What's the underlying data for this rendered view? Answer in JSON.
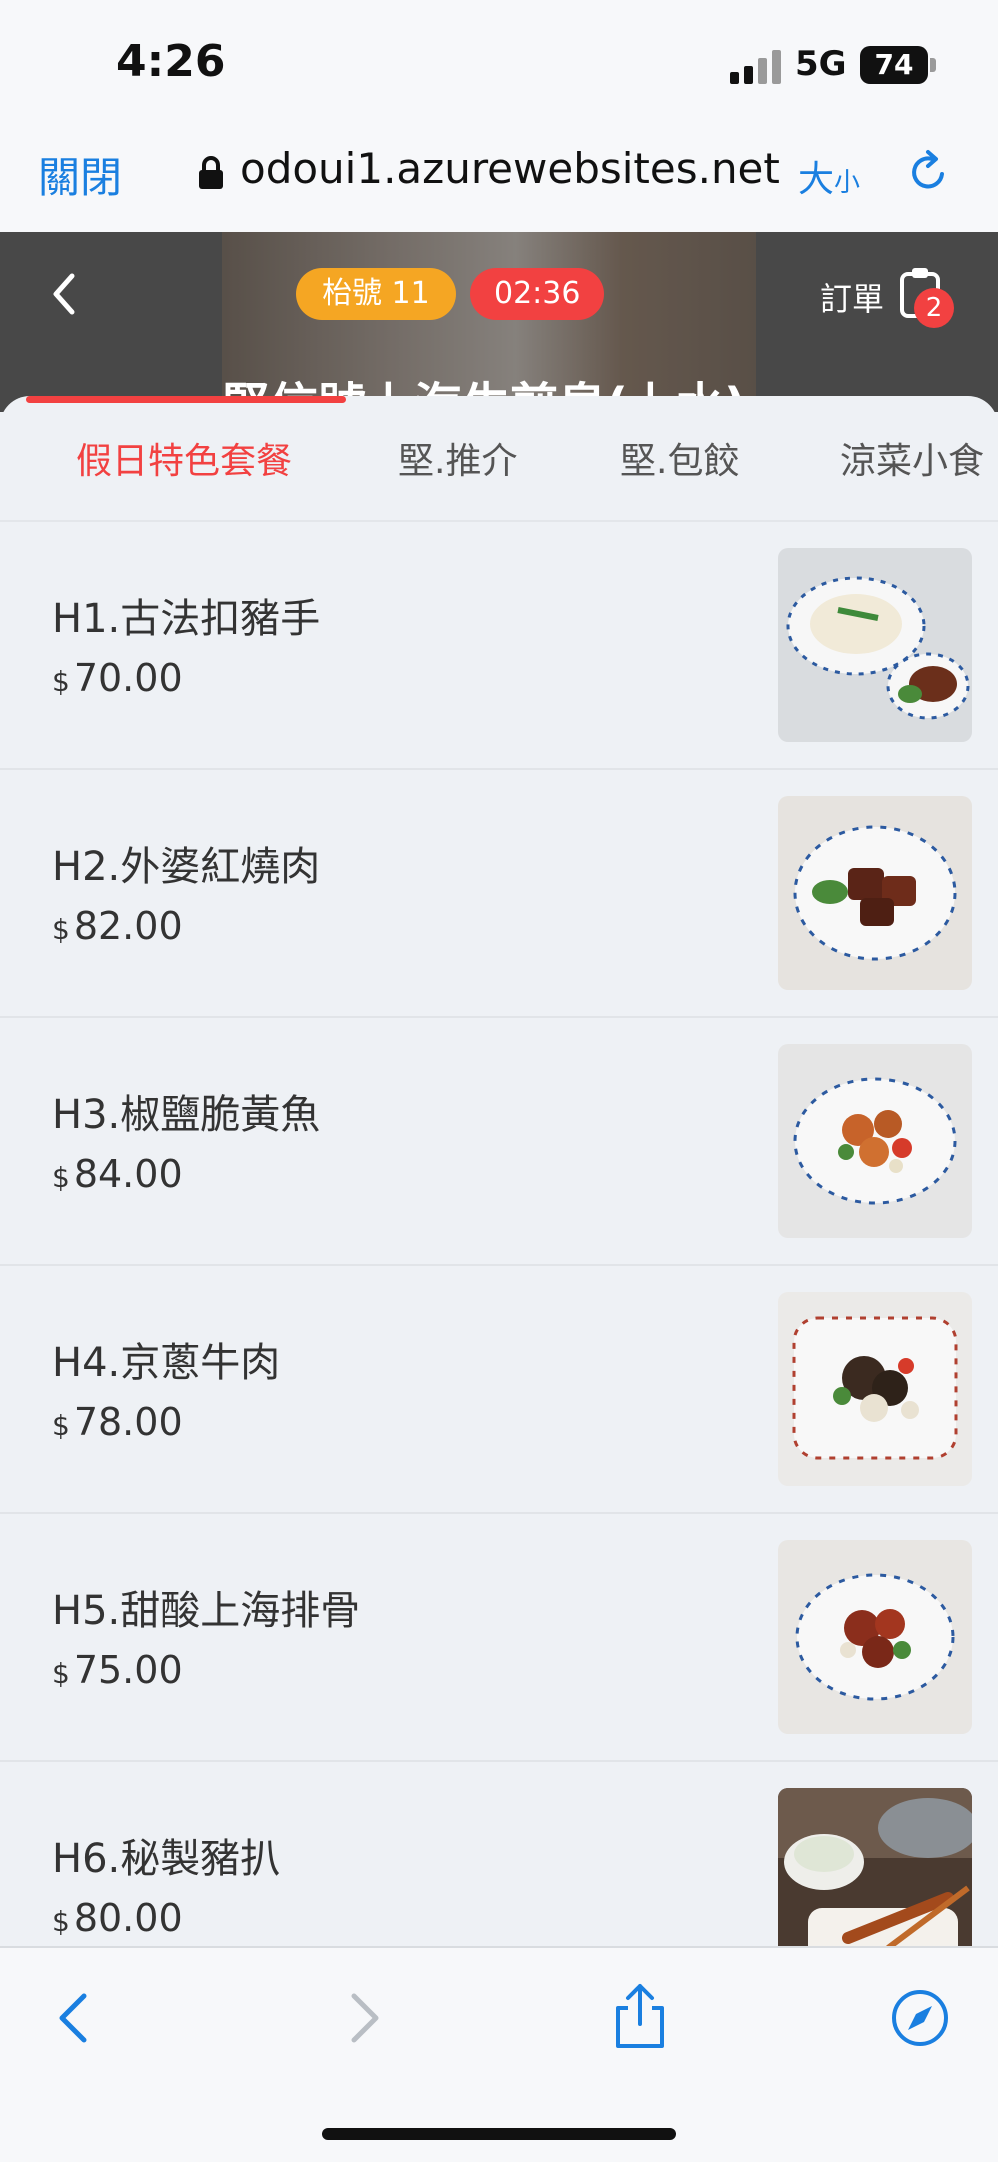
{
  "status_bar": {
    "time": "4:26",
    "network": "5G",
    "battery": "74"
  },
  "browser": {
    "close_label": "關閉",
    "url": "odoui1.azurewebsites.net",
    "text_size_big": "大",
    "text_size_small": "小"
  },
  "header": {
    "table_label": "枱號 11",
    "timer": "02:36",
    "order_label": "訂單",
    "order_count": "2",
    "shop_title": "堅信號上海生煎皇(上水)"
  },
  "tabs": [
    {
      "label": "假日特色套餐",
      "active": true
    },
    {
      "label": "堅.推介",
      "active": false
    },
    {
      "label": "堅.包餃",
      "active": false
    },
    {
      "label": "涼菜小食",
      "active": false
    }
  ],
  "menu": {
    "currency": "$",
    "items": [
      {
        "name": "H1.古法扣豬手",
        "price": "70.00"
      },
      {
        "name": "H2.外婆紅燒肉",
        "price": "82.00"
      },
      {
        "name": "H3.椒鹽脆黃魚",
        "price": "84.00"
      },
      {
        "name": "H4.京蔥牛肉",
        "price": "78.00"
      },
      {
        "name": "H5.甜酸上海排骨",
        "price": "75.00"
      },
      {
        "name": "H6.秘製豬扒",
        "price": "80.00"
      }
    ]
  },
  "colors": {
    "accent": "#f24141",
    "link": "#1a7fe0",
    "badge": "#f5a623"
  },
  "icons": [
    "lock-icon",
    "reload-icon",
    "back-chevron-icon",
    "clipboard-icon",
    "share-icon",
    "compass-icon",
    "forward-icon"
  ]
}
